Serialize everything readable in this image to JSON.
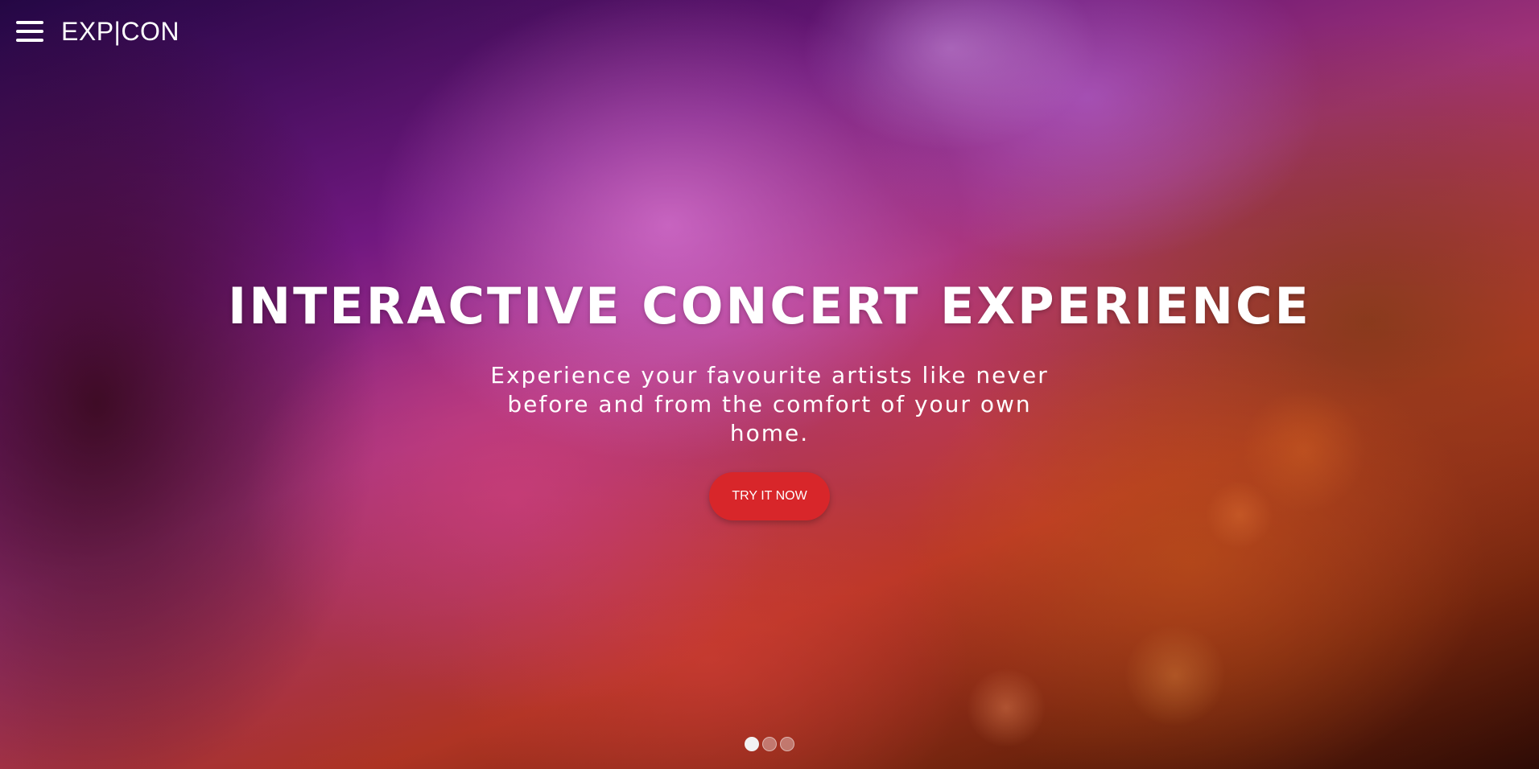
{
  "header": {
    "menu_icon": "hamburger-menu-icon",
    "logo": "EXP|CON"
  },
  "hero": {
    "title": "INTERACTIVE CONCERT EXPERIENCE",
    "subtitle_line1": "Experience your favourite artists like never",
    "subtitle_line2": "before and from the comfort of your own home.",
    "cta_label": "TRY IT NOW",
    "background_description_colors": {
      "purple": "#7a1a8a",
      "pink": "#b83a8a",
      "red": "#d8402c",
      "orange": "#d55a1e"
    }
  },
  "carousel": {
    "slides": 3,
    "active_index": 0
  },
  "colors": {
    "cta": "#d8262a",
    "text": "#ffffff"
  }
}
